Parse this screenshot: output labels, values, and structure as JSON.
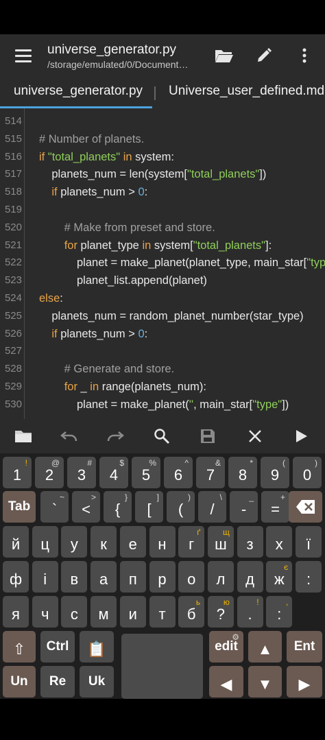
{
  "appbar": {
    "title": "universe_generator.py",
    "path": "/storage/emulated/0/Document…"
  },
  "tabs": [
    {
      "label": "universe_generator.py"
    },
    {
      "label": "Universe_user_defined.md"
    }
  ],
  "editor": {
    "lines": [
      {
        "n": "514",
        "segs": []
      },
      {
        "n": "515",
        "segs": [
          {
            "t": "# Number of planets.",
            "c": "cm"
          }
        ]
      },
      {
        "n": "516",
        "segs": [
          {
            "t": "if ",
            "c": "kw"
          },
          {
            "t": "\"total_planets\"",
            "c": "str"
          },
          {
            "t": " in ",
            "c": "kw"
          },
          {
            "t": "system:",
            "c": ""
          }
        ]
      },
      {
        "n": "517",
        "segs": [
          {
            "t": "    planets_num = len(system[",
            "c": ""
          },
          {
            "t": "\"total_planets\"",
            "c": "str"
          },
          {
            "t": "])",
            "c": ""
          }
        ]
      },
      {
        "n": "518",
        "segs": [
          {
            "t": "    ",
            "c": ""
          },
          {
            "t": "if ",
            "c": "kw"
          },
          {
            "t": "planets_num > ",
            "c": ""
          },
          {
            "t": "0",
            "c": "num"
          },
          {
            "t": ":",
            "c": ""
          }
        ]
      },
      {
        "n": "519",
        "segs": []
      },
      {
        "n": "520",
        "segs": [
          {
            "t": "        # Make from preset and store.",
            "c": "cm"
          }
        ]
      },
      {
        "n": "521",
        "segs": [
          {
            "t": "        ",
            "c": ""
          },
          {
            "t": "for ",
            "c": "kw"
          },
          {
            "t": "planet_type ",
            "c": ""
          },
          {
            "t": "in ",
            "c": "kw"
          },
          {
            "t": "system[",
            "c": ""
          },
          {
            "t": "\"total_planets\"",
            "c": "str"
          },
          {
            "t": "]:",
            "c": ""
          }
        ]
      },
      {
        "n": "522",
        "segs": [
          {
            "t": "            planet = make_planet(planet_type, main_star[",
            "c": ""
          },
          {
            "t": "\"type\"",
            "c": "str"
          },
          {
            "t": "])",
            "c": ""
          }
        ]
      },
      {
        "n": "523",
        "segs": [
          {
            "t": "            planet_list.append(planet)",
            "c": ""
          }
        ]
      },
      {
        "n": "524",
        "segs": [
          {
            "t": "else",
            "c": "kw"
          },
          {
            "t": ":",
            "c": ""
          }
        ]
      },
      {
        "n": "525",
        "segs": [
          {
            "t": "    planets_num = random_planet_number(star_type)",
            "c": ""
          }
        ]
      },
      {
        "n": "526",
        "segs": [
          {
            "t": "    ",
            "c": ""
          },
          {
            "t": "if ",
            "c": "kw"
          },
          {
            "t": "planets_num > ",
            "c": ""
          },
          {
            "t": "0",
            "c": "num"
          },
          {
            "t": ":",
            "c": ""
          }
        ]
      },
      {
        "n": "527",
        "segs": []
      },
      {
        "n": "528",
        "segs": [
          {
            "t": "        # Generate and store.",
            "c": "cm"
          }
        ]
      },
      {
        "n": "529",
        "segs": [
          {
            "t": "        ",
            "c": ""
          },
          {
            "t": "for ",
            "c": "kw"
          },
          {
            "t": "_ ",
            "c": ""
          },
          {
            "t": "in ",
            "c": "kw"
          },
          {
            "t": "range(planets_num):",
            "c": ""
          }
        ]
      },
      {
        "n": "530",
        "segs": [
          {
            "t": "            planet = make_planet(",
            "c": ""
          },
          {
            "t": "''",
            "c": "str"
          },
          {
            "t": ", main_star[",
            "c": ""
          },
          {
            "t": "\"type\"",
            "c": "str"
          },
          {
            "t": "])",
            "c": ""
          }
        ]
      }
    ]
  },
  "keyboard": {
    "row1": [
      {
        "main": "1",
        "sub": "!"
      },
      {
        "main": "2",
        "sub": "@"
      },
      {
        "main": "3",
        "sub": "#"
      },
      {
        "main": "4",
        "sub": "$"
      },
      {
        "main": "5",
        "sub": "%"
      },
      {
        "main": "6",
        "sub": "^"
      },
      {
        "main": "7",
        "sub": "&"
      },
      {
        "main": "8",
        "sub": "*"
      },
      {
        "main": "9",
        "sub": "("
      },
      {
        "main": "0",
        "sub": ")"
      }
    ],
    "row2": [
      {
        "main": "Tab",
        "sub": ""
      },
      {
        "main": "`",
        "sub": "~"
      },
      {
        "main": "<",
        "sub": ">"
      },
      {
        "main": "{",
        "sub": "}"
      },
      {
        "main": "[",
        "sub": "]"
      },
      {
        "main": "(",
        "sub": ")"
      },
      {
        "main": "/",
        "sub": "\\"
      },
      {
        "main": "-",
        "sub": "_"
      },
      {
        "main": "=",
        "sub": "+"
      }
    ],
    "row3": [
      {
        "main": "й",
        "sub": ""
      },
      {
        "main": "ц",
        "sub": ""
      },
      {
        "main": "у",
        "sub": ""
      },
      {
        "main": "к",
        "sub": ""
      },
      {
        "main": "е",
        "sub": ""
      },
      {
        "main": "н",
        "sub": ""
      },
      {
        "main": "г",
        "sub": "ґ"
      },
      {
        "main": "ш",
        "sub": "щ"
      },
      {
        "main": "з",
        "sub": ""
      },
      {
        "main": "х",
        "sub": ""
      },
      {
        "main": "ї",
        "sub": ""
      }
    ],
    "row4": [
      {
        "main": "ф",
        "sub": ""
      },
      {
        "main": "і",
        "sub": ""
      },
      {
        "main": "в",
        "sub": ""
      },
      {
        "main": "а",
        "sub": ""
      },
      {
        "main": "п",
        "sub": ""
      },
      {
        "main": "р",
        "sub": ""
      },
      {
        "main": "о",
        "sub": ""
      },
      {
        "main": "л",
        "sub": ""
      },
      {
        "main": "д",
        "sub": ""
      },
      {
        "main": "ж",
        "sub": "є"
      },
      {
        "main": ":",
        "sub": ""
      }
    ],
    "row5": [
      {
        "main": "я",
        "sub": ""
      },
      {
        "main": "ч",
        "sub": ""
      },
      {
        "main": "с",
        "sub": ""
      },
      {
        "main": "м",
        "sub": ""
      },
      {
        "main": "и",
        "sub": ""
      },
      {
        "main": "т",
        "sub": ""
      },
      {
        "main": "б",
        "sub": "ь"
      },
      {
        "main": "?",
        "sub": "ю"
      },
      {
        "main": ".",
        "sub": "!"
      },
      {
        "main": ":",
        "sub": ","
      }
    ],
    "row6": [
      {
        "main": "⇧",
        "sub": ""
      },
      {
        "main": "Ctrl",
        "sub": ""
      },
      {
        "main": "📋",
        "sub": ""
      },
      {
        "main": "",
        "sub": ""
      },
      {
        "main": "edit",
        "sub": "⚙"
      },
      {
        "main": "▲",
        "sub": ""
      },
      {
        "main": "Ent",
        "sub": ""
      }
    ],
    "row7": [
      {
        "main": "Un",
        "sub": ""
      },
      {
        "main": "Re",
        "sub": ""
      },
      {
        "main": "Uk",
        "sub": ""
      },
      {
        "main": "◀",
        "sub": ""
      },
      {
        "main": "▼",
        "sub": ""
      },
      {
        "main": "▶",
        "sub": ""
      }
    ]
  }
}
